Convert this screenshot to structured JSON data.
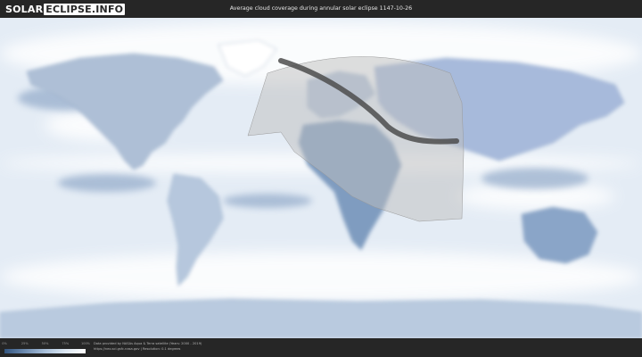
{
  "header": {
    "logo_solar": "SOLAR",
    "logo_eclipse_info": "ECLIPSE.INFO",
    "title": "Average cloud coverage during annular solar eclipse 1147-10-26"
  },
  "legend": {
    "ticks": [
      "0%",
      "25%",
      "50%",
      "75%",
      "100%"
    ],
    "gradient_colors": [
      "#33557f",
      "#6d8bb0",
      "#a9c0da",
      "#dde8f3",
      "#ffffff"
    ]
  },
  "footer": {
    "credit_line1": "Data provided by NASAs Aqua & Terra satellite (Years: 2000 - 2019)",
    "credit_line2": "https://neo.sci.gsfc.nasa.gov | Resolution: 0.1 degrees"
  },
  "map": {
    "ocean_color": "#e9f0f7",
    "cloud_color": "#ffffff",
    "clear_color": "#6f8db3",
    "visibility_region_color": "#b9b9b9",
    "annular_path_color": "#4a4a4a"
  }
}
